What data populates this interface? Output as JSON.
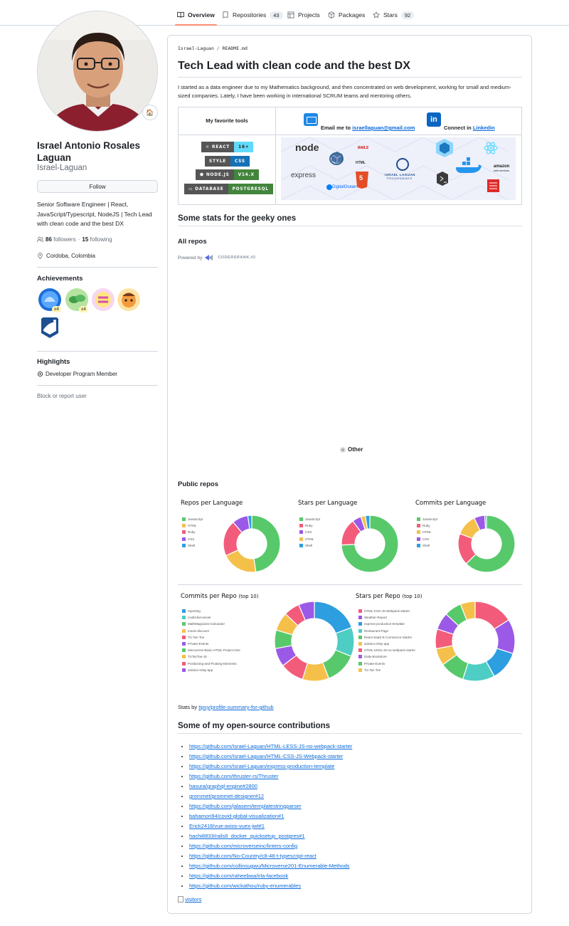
{
  "tabs": [
    {
      "label": "Overview",
      "count": ""
    },
    {
      "label": "Repositories",
      "count": "43"
    },
    {
      "label": "Projects",
      "count": ""
    },
    {
      "label": "Packages",
      "count": ""
    },
    {
      "label": "Stars",
      "count": "92"
    }
  ],
  "profile": {
    "status_emoji": "🏠",
    "name": "Israel Antonio Rosales Laguan",
    "login": "Israel-Laguan",
    "follow_label": "Follow",
    "bio": "Senior Software Engineer | React, JavaScript/Typescript, NodeJS | Tech Lead with clean code and the best DX",
    "followers": "86",
    "followers_label": "followers",
    "following": "15",
    "following_label": "following",
    "location": "Cordoba, Colombia",
    "achievements_title": "Achievements",
    "achievement_counts": [
      "x4",
      "x4"
    ],
    "highlights_title": "Highlights",
    "highlight_item": "Developer Program Member",
    "block_label": "Block or report user"
  },
  "readme": {
    "crumb_user": "Israel-Laguan",
    "crumb_sep": "/",
    "crumb_file": "README.md",
    "title": "Tech Lead with clean code and the best DX",
    "intro": "I started as a data engineer due to my Mathematics background, and then concentrated on web development, working for small and medium-sized companies. Lately, I have been working in international SCRUM teams and mentoring others.",
    "fav_tools": "My favorite tools",
    "email_prefix": "Email me to ",
    "email": "israellaguan@gmail.com",
    "connect_prefix": "Connect in ",
    "linkedin": "Linkedin",
    "linkedin_icon": "in",
    "shields": [
      {
        "left": "REACT",
        "right": "16+",
        "color": "#61dafb",
        "textColor": "#222"
      },
      {
        "left": "STYLE",
        "right": "CSS",
        "color": "#1572b6",
        "textColor": "#fff"
      },
      {
        "left": "NODE.JS",
        "right": "V14.X",
        "color": "#43853d",
        "textColor": "#fff"
      },
      {
        "left": "DATABASE",
        "right": "POSTGRESQL",
        "color": "#316192",
        "textColor": "#fff"
      }
    ],
    "logo_labels": {
      "node": "node",
      "express": "express",
      "rails": "RAILS",
      "html": "HTML",
      "html_badge": "5",
      "israel_1": "ISRAEL LAGUAN",
      "israel_2": "PROGRAMMER",
      "amazon_1": "amazon",
      "amazon_2": "web services",
      "digitalocean": "DigitalOcean"
    },
    "stats_heading": "Some stats for the geeky ones",
    "all_repos": "All repos",
    "powered_by": "Powered by",
    "codersrank": "CODERSRANK.IO",
    "other_label": "Other",
    "public_repos": "Public repos",
    "stats_by_prefix": "Stats by ",
    "stats_by_link": "tipsy/profile-summary-for-github",
    "contrib_heading": "Some of my open-source contributions",
    "contributions": [
      "https://github.com/Israel-Laguan/HTML-LESS-JS-no-webpack-starter",
      "https://github.com/Israel-Laguan/HTML-CSS-JS-Webpack-starter",
      "https://github.com/Israel-Laguan/express-production-template",
      "https://github.com/thruster-rs/Thruster",
      "hasura/graphql-engine#2800",
      "grommet/grommet-designer#12",
      "https://github.com/jalasem/templatestringparser",
      "bahamon94/covid-global-visualization#1",
      "Erick2418/vue-axios-vuex-jwt#1",
      "hachi8833/rails6_docker_quicksetup_postgres#1",
      "https://github.com/microverseinc/linters-config",
      "https://github.com/No-Country/c8-48-t-typescript-react",
      "https://github.com/collinsugwu/Microverse201-Enumerable-Methods",
      "https://github.com/raheebwa/irla-facebook",
      "https://github.com/wickathou/ruby-enumerables"
    ],
    "visitors_alt": "visitors"
  },
  "colors": {
    "JavaScript": "#58c96b",
    "HTML": "#f5c04a",
    "Ruby": "#f25c7a",
    "CSS": "#9b59e8",
    "Shell": "#2d9ee0",
    "teal": "#4ecdc4",
    "orange": "#f5a742"
  },
  "chart_data": [
    {
      "type": "pie",
      "title": "Repos per Language",
      "categories": [
        "JavaScript",
        "HTML",
        "Ruby",
        "CSS",
        "Shell"
      ],
      "values": [
        21,
        9,
        9,
        4,
        1
      ],
      "colors": [
        "#58c96b",
        "#f5c04a",
        "#f25c7a",
        "#9b59e8",
        "#2d9ee0"
      ]
    },
    {
      "type": "pie",
      "title": "Stars per Language",
      "categories": [
        "JavaScript",
        "Ruby",
        "CSS",
        "HTML",
        "Shell"
      ],
      "values": [
        58,
        12,
        4,
        2,
        2
      ],
      "colors": [
        "#58c96b",
        "#f25c7a",
        "#9b59e8",
        "#f5c04a",
        "#2d9ee0"
      ]
    },
    {
      "type": "pie",
      "title": "Commits per Language",
      "categories": [
        "JavaScript",
        "Ruby",
        "HTML",
        "CSS",
        "Shell"
      ],
      "values": [
        62,
        18,
        12,
        6,
        1
      ],
      "colors": [
        "#58c96b",
        "#f25c7a",
        "#f5c04a",
        "#9b59e8",
        "#2d9ee0"
      ]
    },
    {
      "type": "pie",
      "title": "Commits per Repo",
      "subtitle": "(top 10)",
      "categories": [
        "reporting",
        "coolticket-server",
        "MathMagicians-Calculator",
        "movie-discover",
        "Tic-Tac-Toe",
        "Private-Events",
        "Microverse-Basic-HTML-Project-One",
        "TicTacToe-JS",
        "Positioning-and-Floating-Elements",
        "arduino-relay-app"
      ],
      "values": [
        18,
        11,
        12,
        10,
        9,
        7,
        7,
        7,
        6,
        6
      ],
      "colors": [
        "#2d9ee0",
        "#4ecdc4",
        "#58c96b",
        "#f5c04a",
        "#f25c7a",
        "#9b59e8",
        "#58c96b",
        "#f5c04a",
        "#f25c7a",
        "#9b59e8"
      ]
    },
    {
      "type": "pie",
      "title": "Stars per Repo",
      "subtitle": "(top 10)",
      "categories": [
        "HTML-CSS-JS-Webpack-starter",
        "Weather-Report",
        "express-production-template",
        "Restaurant-Page",
        "React-SaaS-E-Commerce-Starter",
        "arduino-relay-app",
        "HTML-LESS-JS-no-webpack-starter",
        "Daily-Bookstore",
        "Private-Events",
        "Tic-Tac-Toe"
      ],
      "values": [
        16,
        14,
        12,
        13,
        10,
        7,
        8,
        7,
        7,
        6
      ],
      "colors": [
        "#f25c7a",
        "#9b59e8",
        "#2d9ee0",
        "#4ecdc4",
        "#58c96b",
        "#f5c04a",
        "#f25c7a",
        "#9b59e8",
        "#58c96b",
        "#f5c04a"
      ]
    }
  ]
}
